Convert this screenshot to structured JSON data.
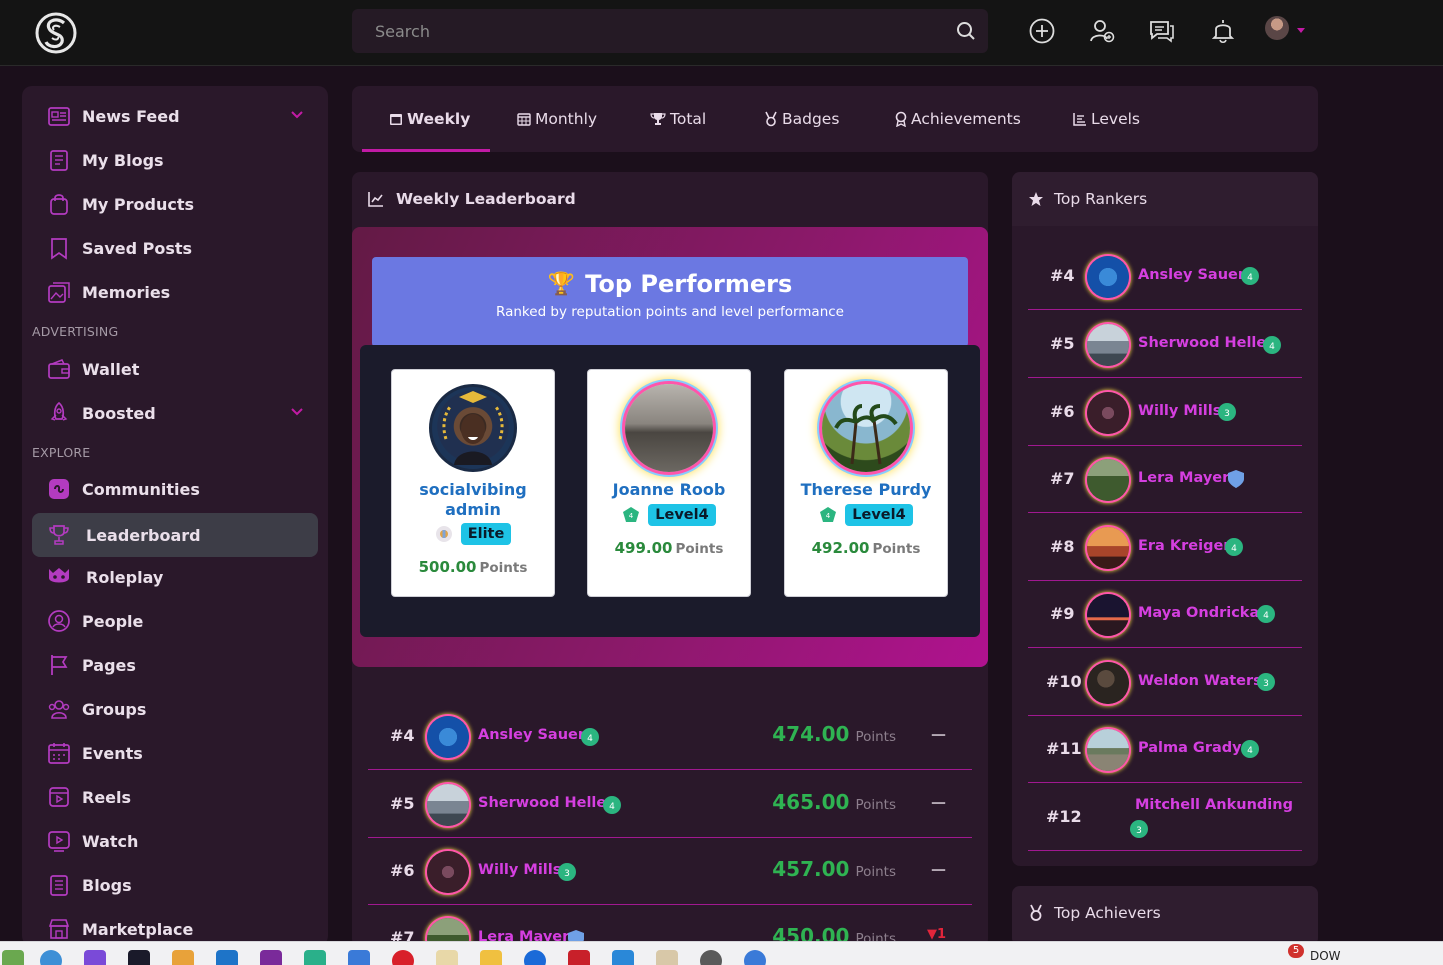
{
  "header": {
    "search_placeholder": "Search"
  },
  "sidebar": {
    "items": [
      {
        "label": "News Feed",
        "icon": "news-icon"
      },
      {
        "label": "My Blogs",
        "icon": "blog-icon"
      },
      {
        "label": "My Products",
        "icon": "bag-icon"
      },
      {
        "label": "Saved Posts",
        "icon": "bookmark-icon"
      },
      {
        "label": "Memories",
        "icon": "memories-icon"
      },
      {
        "label": "Wallet",
        "icon": "wallet-icon"
      },
      {
        "label": "Boosted",
        "icon": "rocket-icon"
      },
      {
        "label": "Communities",
        "icon": "communities-icon"
      },
      {
        "label": "Leaderboard",
        "icon": "trophy-icon"
      },
      {
        "label": "Roleplay",
        "icon": "mask-icon"
      },
      {
        "label": "People",
        "icon": "people-icon"
      },
      {
        "label": "Pages",
        "icon": "flag-icon"
      },
      {
        "label": "Groups",
        "icon": "groups-icon"
      },
      {
        "label": "Events",
        "icon": "calendar-icon"
      },
      {
        "label": "Reels",
        "icon": "reels-icon"
      },
      {
        "label": "Watch",
        "icon": "watch-icon"
      },
      {
        "label": "Blogs",
        "icon": "blogs-icon"
      },
      {
        "label": "Marketplace",
        "icon": "store-icon"
      }
    ],
    "sections": {
      "advertising": "ADVERTISING",
      "explore": "EXPLORE"
    }
  },
  "tabs": [
    {
      "label": "Weekly",
      "icon": "calendar-icon"
    },
    {
      "label": "Monthly",
      "icon": "calendar-grid-icon"
    },
    {
      "label": "Total",
      "icon": "trophy-icon"
    },
    {
      "label": "Badges",
      "icon": "medal-icon"
    },
    {
      "label": "Achievements",
      "icon": "award-icon"
    },
    {
      "label": "Levels",
      "icon": "chart-icon"
    }
  ],
  "main": {
    "title": "Weekly Leaderboard",
    "hero_title": "Top Performers",
    "hero_trophy": "🏆",
    "hero_subtitle": "Ranked by reputation points and level performance",
    "points_unit": "Points",
    "podium": [
      {
        "name": "socialvibing admin",
        "badge": "Elite",
        "points": "500.00"
      },
      {
        "name": "Joanne Roob",
        "badge": "Level4",
        "points": "499.00"
      },
      {
        "name": "Therese Purdy",
        "badge": "Level4",
        "points": "492.00"
      }
    ],
    "ranks": [
      {
        "rank": "#4",
        "name": "Ansley Sauer",
        "points": "474.00",
        "change": "—"
      },
      {
        "rank": "#5",
        "name": "Sherwood Heller",
        "points": "465.00",
        "change": "—"
      },
      {
        "rank": "#6",
        "name": "Willy Mills",
        "points": "457.00",
        "change": "—"
      },
      {
        "rank": "#7",
        "name": "Lera Mayer",
        "points": "450.00",
        "change": "▼1"
      }
    ]
  },
  "top_rankers": {
    "title": "Top Rankers",
    "items": [
      {
        "rank": "#4",
        "name": "Ansley Sauer"
      },
      {
        "rank": "#5",
        "name": "Sherwood Heller"
      },
      {
        "rank": "#6",
        "name": "Willy Mills"
      },
      {
        "rank": "#7",
        "name": "Lera Mayer"
      },
      {
        "rank": "#8",
        "name": "Era Kreiger"
      },
      {
        "rank": "#9",
        "name": "Maya Ondricka"
      },
      {
        "rank": "#10",
        "name": "Weldon Waters"
      },
      {
        "rank": "#11",
        "name": "Palma Grady"
      },
      {
        "rank": "#12",
        "name": "Mitchell Ankunding"
      }
    ]
  },
  "top_achievers": {
    "title": "Top Achievers"
  },
  "taskbar": {
    "notification_count": "5",
    "tray_label": "DOW"
  }
}
